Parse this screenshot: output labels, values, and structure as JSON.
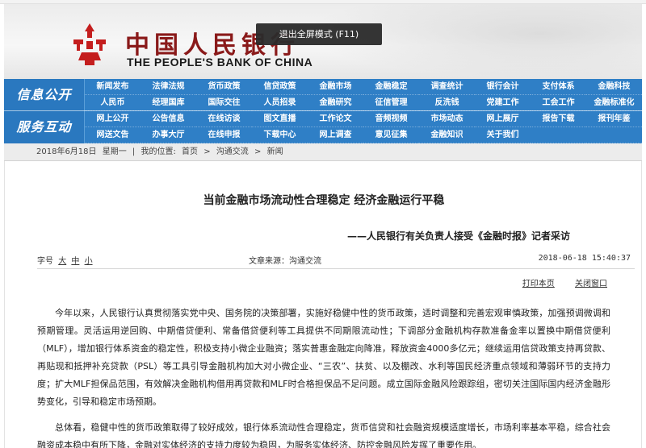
{
  "header": {
    "title_cn": "中国人民银行",
    "title_en": "THE PEOPLE'S BANK OF CHINA",
    "fullscreen_tip": "退出全屏模式 (F11)"
  },
  "nav": {
    "group1": {
      "label": "信息公开",
      "items": [
        "新闻发布",
        "法律法规",
        "货币政策",
        "信贷政策",
        "金融市场",
        "金融稳定",
        "调查统计",
        "银行会计",
        "支付体系",
        "金融科技",
        "人民币",
        "经理国库",
        "国际交往",
        "人员招录",
        "金融研究",
        "征信管理",
        "反洗钱",
        "党建工作",
        "工会工作",
        "金融标准化"
      ]
    },
    "group2": {
      "label": "服务互动",
      "items": [
        "网上公开",
        "公告信息",
        "在线访谈",
        "图文直播",
        "工作论文",
        "音频视频",
        "市场动态",
        "网上展厅",
        "报告下载",
        "报刊年鉴",
        "网送文告",
        "办事大厅",
        "在线申报",
        "下载中心",
        "网上调查",
        "意见征集",
        "金融知识",
        "关于我们",
        "",
        ""
      ]
    }
  },
  "breadcrumb": {
    "date": "2018年6月18日",
    "weekday": "星期一",
    "separator": "|",
    "prefix": "我的位置:",
    "items": [
      "首页",
      "沟通交流",
      "新闻"
    ],
    "arrow": ">"
  },
  "article": {
    "title": "当前金融市场流动性合理稳定  经济金融运行平稳",
    "subtitle": "——人民银行有关负责人接受《金融时报》记者采访",
    "font_size_label": "字号",
    "font_sizes": [
      "大",
      "中",
      "小"
    ],
    "source": "文章来源：沟通交流",
    "date": "2018-06-18 15:40:37",
    "print_label": "打印本页",
    "close_label": "关闭窗口",
    "paragraphs": [
      "今年以来，人民银行认真贯彻落实党中央、国务院的决策部署，实施好稳健中性的货币政策，适时调整和完善宏观审慎政策，加强预调微调和预期管理。灵活运用逆回购、中期借贷便利、常备借贷便利等工具提供不同期限流动性；下调部分金融机构存款准备金率以置换中期借贷便利（MLF），增加银行体系资金的稳定性，积极支持小微企业融资；落实普惠金融定向降准，释放资金4000多亿元；继续运用信贷政策支持再贷款、再贴现和抵押补充贷款（PSL）等工具引导金融机构加大对小微企业、“三农”、扶贫、以及棚改、水利等国民经济重点领域和薄弱环节的支持力度；扩大MLF担保品范围，有效解决金融机构借用再贷款和MLF时合格担保品不足问题。成立国际金融风险跟踪组，密切关注国际国内经济金融形势变化，引导和稳定市场预期。",
      "总体看，稳健中性的货币政策取得了较好成效，银行体系流动性合理稳定，货币信贷和社会融资规模适度增长，市场利率基本平稳，综合社会融资成本稳中有所下降，金融对实体经济的支持力度较为稳固，为服务实体经济、防控金融风险发挥了重要作用。"
    ]
  },
  "colors": {
    "nav_blue": "#2f7fc6",
    "brand_red": "#c41e1e"
  }
}
